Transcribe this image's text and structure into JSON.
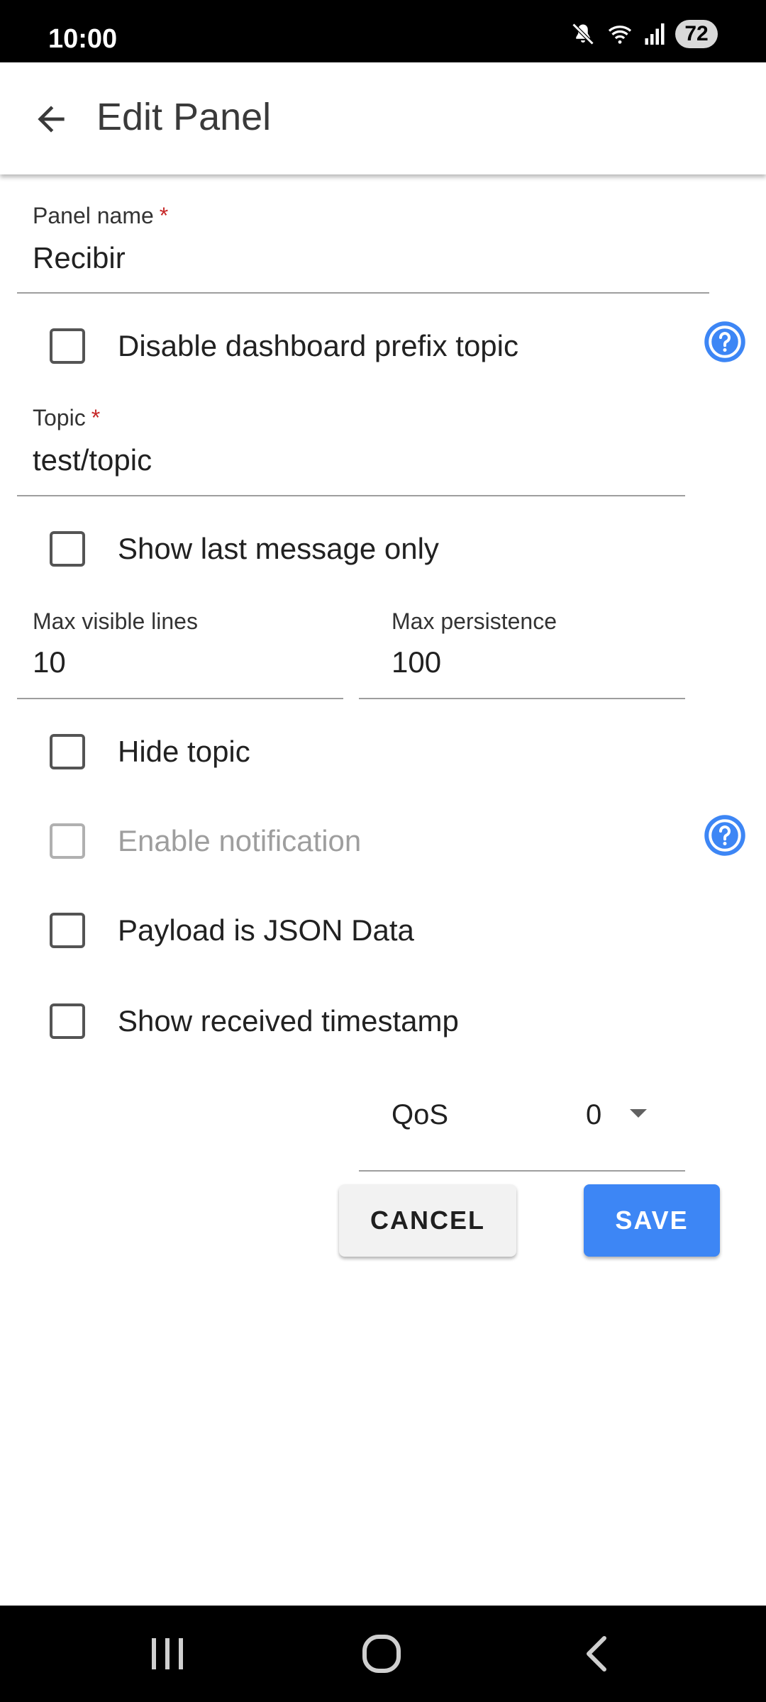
{
  "status_bar": {
    "time": "10:00",
    "battery": "72",
    "icons": [
      "mute-icon",
      "wifi-icon",
      "signal-icon"
    ]
  },
  "app_bar": {
    "title": "Edit Panel",
    "back_icon": "arrow-back-icon"
  },
  "form": {
    "panel_name": {
      "label": "Panel name",
      "required_mark": "*",
      "value": "Recibir"
    },
    "disable_prefix": {
      "label": "Disable dashboard prefix topic",
      "checked": false
    },
    "topic": {
      "label": "Topic",
      "required_mark": "*",
      "value": "test/topic"
    },
    "show_last": {
      "label": "Show last message only",
      "checked": false
    },
    "max_visible_lines": {
      "label": "Max visible lines",
      "value": "10"
    },
    "max_persistence": {
      "label": "Max persistence",
      "value": "100"
    },
    "hide_topic": {
      "label": "Hide topic",
      "checked": false
    },
    "enable_notification": {
      "label": "Enable notification",
      "checked": false,
      "disabled": true
    },
    "payload_json": {
      "label": "Payload is JSON Data",
      "checked": false
    },
    "show_timestamp": {
      "label": "Show received timestamp",
      "checked": false
    },
    "qos": {
      "label": "QoS",
      "value": "0"
    }
  },
  "buttons": {
    "cancel": "CANCEL",
    "save": "SAVE"
  },
  "colors": {
    "accent": "#3d86f5",
    "required": "#c62828",
    "help_icon": "#3d86f5"
  }
}
